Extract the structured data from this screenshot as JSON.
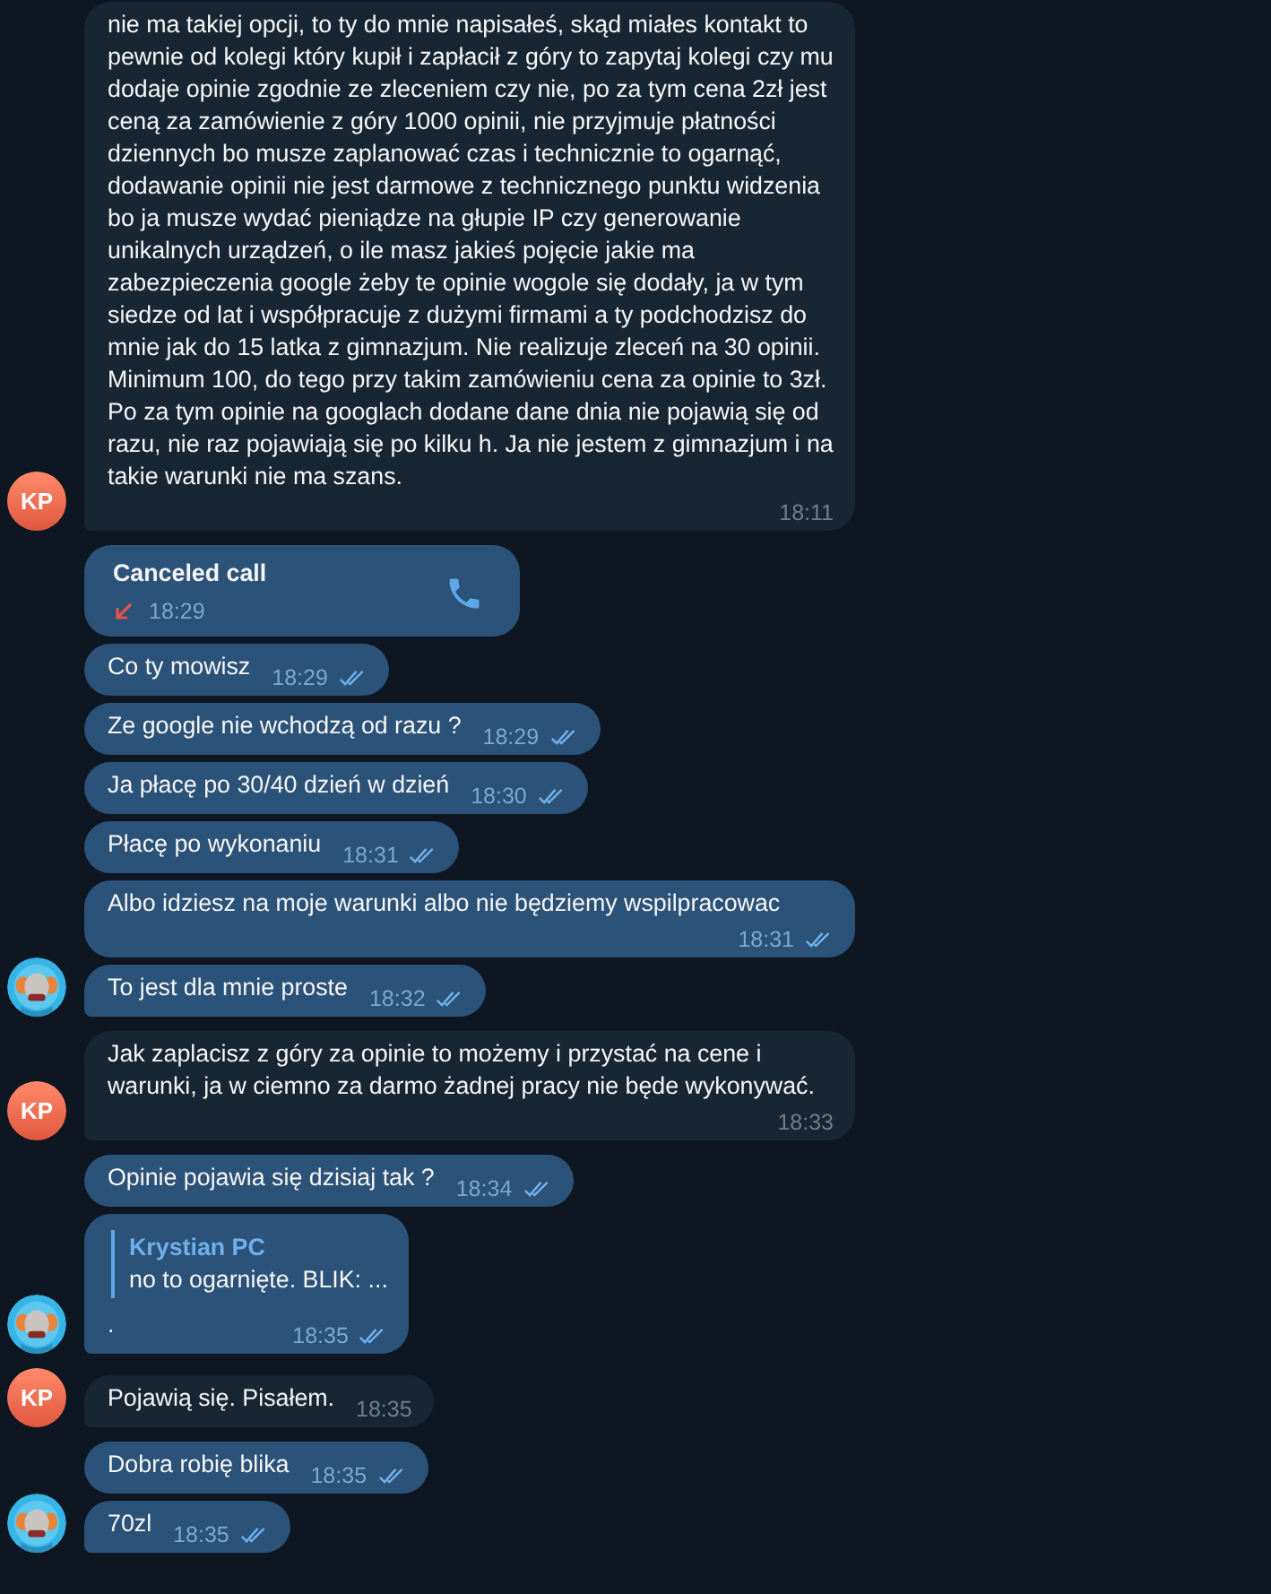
{
  "groups": [
    {
      "outgoing": false,
      "avatar": {
        "kind": "initials",
        "text": "KP"
      },
      "messages": [
        {
          "kind": "text",
          "text": "nie ma takiej opcji, to ty do mnie napisałeś, skąd miałes kontakt to pewnie od kolegi który kupił i zapłacił z góry to zapytaj kolegi czy mu dodaje opinie zgodnie ze zleceniem czy nie, po za tym cena 2zł jest ceną za zamówienie z góry 1000 opinii, nie przyjmuje płatności dziennych bo musze zaplanować czas i technicznie to ogarnąć, dodawanie opinii nie jest darmowe z technicznego punktu widzenia bo ja musze wydać pieniądze na głupie IP czy generowanie unikalnych urządzeń, o ile masz jakieś pojęcie jakie ma zabezpieczenia google żeby te opinie wogole się dodały, ja w tym siedze od lat i współpracuje z dużymi firmami a ty podchodzisz do mnie jak do 15 latka z gimnazjum. Nie realizuje zleceń na 30 opinii. Minimum 100, do tego przy takim zamówieniu cena za opinie to 3zł. Po za tym opinie na googlach dodane dane dnia nie pojawią się od razu, nie raz pojawiają się po kilku h. Ja nie jestem z gimnazjum i na takie warunki nie ma szans.",
          "time": "18:11"
        }
      ]
    },
    {
      "outgoing": true,
      "messages": [
        {
          "kind": "call",
          "title": "Canceled call",
          "missed": true,
          "time": "18:29"
        },
        {
          "kind": "text",
          "text": "Co ty mowisz",
          "time": "18:29",
          "read": true
        },
        {
          "kind": "text",
          "text": "Ze google nie wchodzą od razu ?",
          "time": "18:29",
          "read": true
        },
        {
          "kind": "text",
          "text": "Ja płacę po 30/40 dzień w dzień",
          "time": "18:30",
          "read": true
        },
        {
          "kind": "text",
          "text": "Płacę po wykonaniu",
          "time": "18:31",
          "read": true
        },
        {
          "kind": "text",
          "text": "Albo idziesz na moje warunki albo nie będziemy wspilpracowac",
          "time": "18:31",
          "read": true
        },
        {
          "kind": "text",
          "text": "To jest dla mnie proste",
          "time": "18:32",
          "read": true
        }
      ]
    },
    {
      "outgoing": false,
      "avatar": {
        "kind": "initials",
        "text": "KP"
      },
      "messages": [
        {
          "kind": "text",
          "text": "Jak zaplacisz z góry za opinie to możemy i przystać na cene i warunki, ja w ciemno za darmo żadnej pracy nie będe wykonywać.",
          "time": "18:33"
        }
      ]
    },
    {
      "outgoing": true,
      "messages": [
        {
          "kind": "text",
          "text": "Opinie pojawia się dzisiaj tak ?",
          "time": "18:34",
          "read": true
        },
        {
          "kind": "reply",
          "quote_author": "Krystian PC",
          "quote_text": "no to ogarnięte. BLIK: ...",
          "text": ".",
          "time": "18:35",
          "read": true
        }
      ]
    },
    {
      "outgoing": false,
      "avatar": {
        "kind": "initials",
        "text": "KP"
      },
      "messages": [
        {
          "kind": "text",
          "text": "Pojawią się. Pisałem.",
          "time": "18:35"
        }
      ]
    },
    {
      "outgoing": true,
      "messages": [
        {
          "kind": "text",
          "text": "Dobra robię blika",
          "time": "18:35",
          "read": true
        },
        {
          "kind": "text",
          "text": "70zl",
          "time": "18:35",
          "read": true
        }
      ]
    }
  ]
}
